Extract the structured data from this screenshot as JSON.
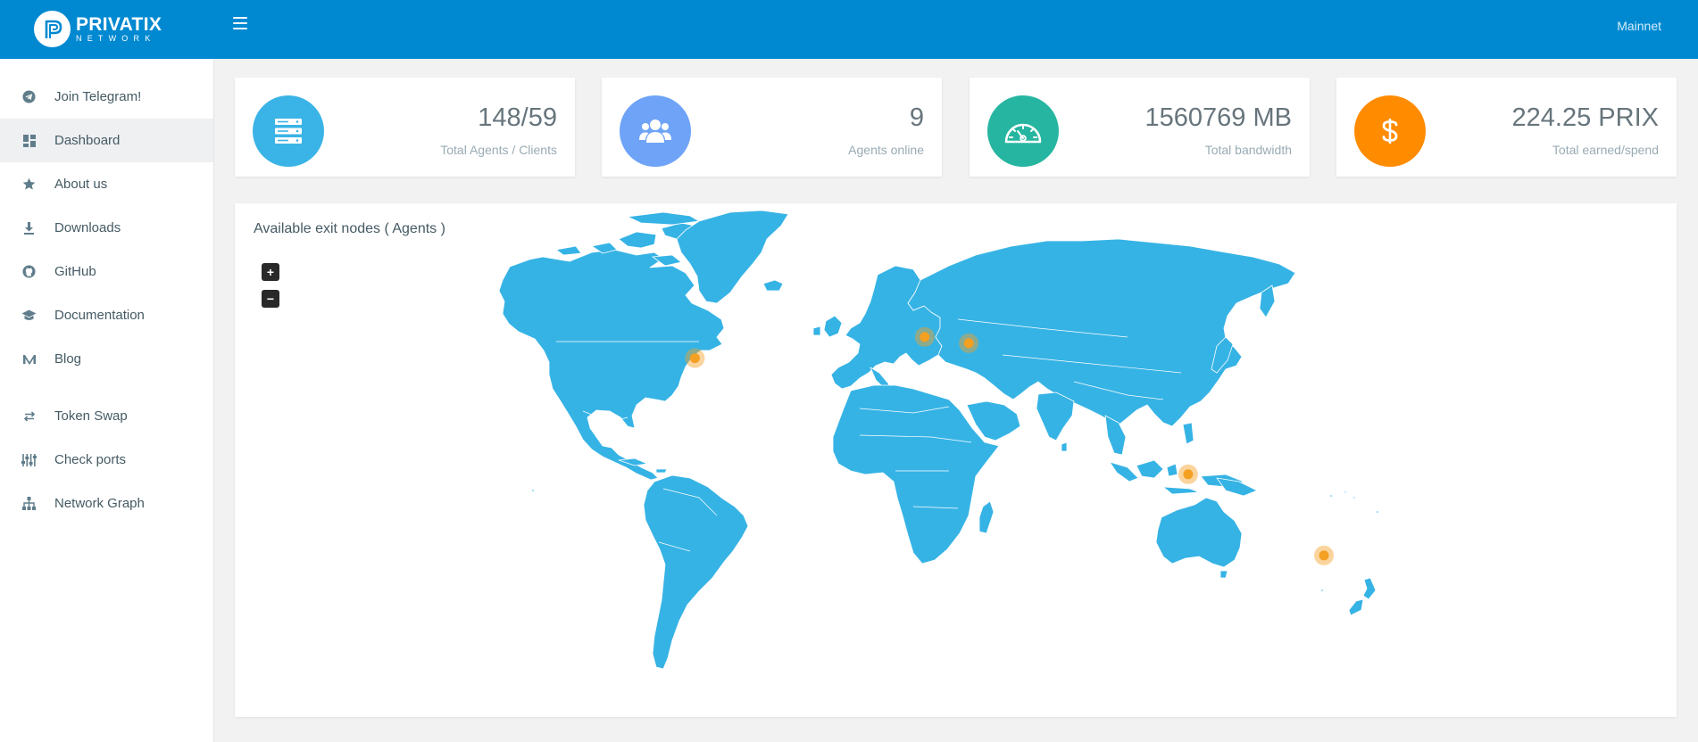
{
  "brand": {
    "name": "PRIVATIX",
    "sub": "NETWORK"
  },
  "header": {
    "network": "Mainnet"
  },
  "sidebar": {
    "items": [
      {
        "label": "Join Telegram!",
        "icon": "telegram-icon"
      },
      {
        "label": "Dashboard",
        "icon": "dashboard-icon",
        "active": true
      },
      {
        "label": "About us",
        "icon": "star-icon"
      },
      {
        "label": "Downloads",
        "icon": "download-icon"
      },
      {
        "label": "GitHub",
        "icon": "github-icon"
      },
      {
        "label": "Documentation",
        "icon": "graduation-cap-icon"
      },
      {
        "label": "Blog",
        "icon": "medium-icon"
      },
      {
        "label": "Token Swap",
        "icon": "swap-icon"
      },
      {
        "label": "Check ports",
        "icon": "sliders-icon"
      },
      {
        "label": "Network Graph",
        "icon": "sitemap-icon"
      }
    ]
  },
  "stats": [
    {
      "value": "148/59",
      "label": "Total Agents / Clients",
      "color": "#3ab4e6",
      "icon": "server-icon"
    },
    {
      "value": "9",
      "label": "Agents online",
      "color": "#6ea3f7",
      "icon": "users-icon"
    },
    {
      "value": "1560769 MB",
      "label": "Total bandwidth",
      "color": "#26b5a0",
      "icon": "speedometer-icon"
    },
    {
      "value": "224.25 PRIX",
      "label": "Total earned/spend",
      "color": "#ff8b00",
      "icon": "dollar-icon"
    }
  ],
  "map": {
    "title": "Available exit nodes ( Agents )",
    "zoom_in": "+",
    "zoom_out": "−",
    "land_color": "#36b3e5",
    "marker_color": "#f4a023",
    "markers": [
      {
        "region": "United States",
        "lat": 38,
        "lon": -97
      },
      {
        "region": "France",
        "lat": 46.5,
        "lon": 2
      },
      {
        "region": "Serbia",
        "lat": 44,
        "lon": 21
      },
      {
        "region": "Indonesia",
        "lat": -8.5,
        "lon": 115.5
      },
      {
        "region": "New Zealand",
        "lat": -41,
        "lon": 174
      }
    ]
  }
}
